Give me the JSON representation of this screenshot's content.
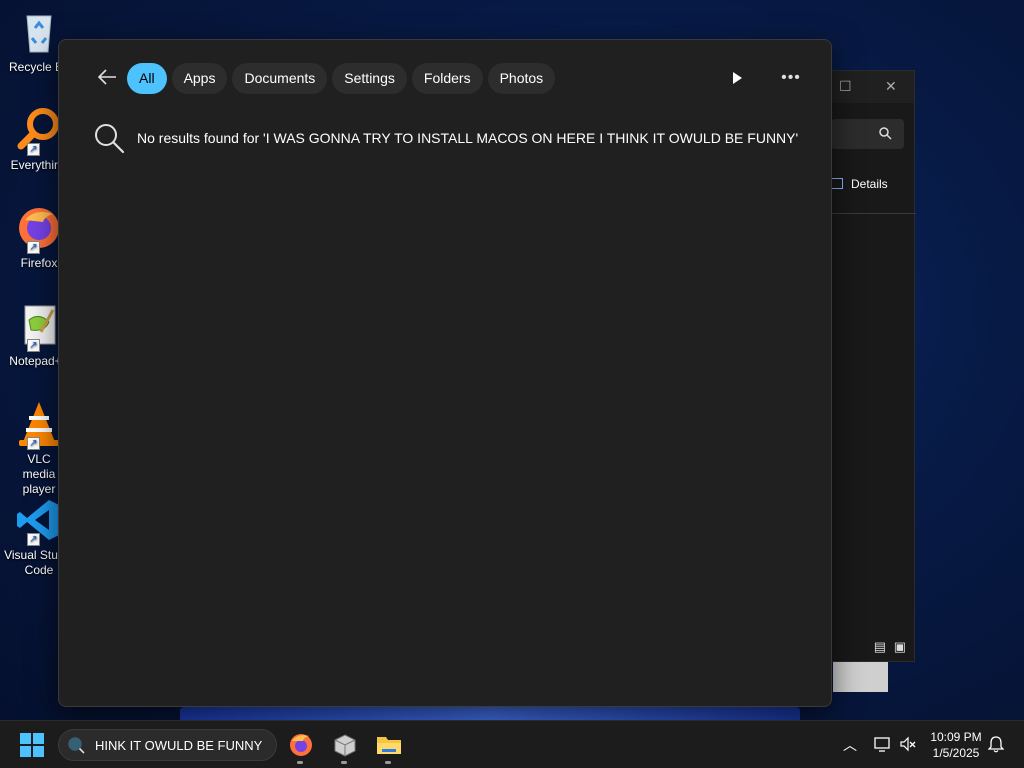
{
  "desktop": {
    "icons": [
      {
        "label": "Recycle Bin",
        "icon": "recycle-bin-icon"
      },
      {
        "label": "Everything",
        "icon": "everything-search-icon"
      },
      {
        "label": "Firefox",
        "icon": "firefox-icon"
      },
      {
        "label": "Notepad++",
        "icon": "notepad-plus-plus-icon"
      },
      {
        "label": "VLC media player",
        "icon": "vlc-icon"
      },
      {
        "label": "Visual Studio Code",
        "icon": "vscode-icon"
      }
    ]
  },
  "explorer": {
    "details_label": "Details"
  },
  "search_flyout": {
    "filters": [
      {
        "label": "All",
        "active": true
      },
      {
        "label": "Apps",
        "active": false
      },
      {
        "label": "Documents",
        "active": false
      },
      {
        "label": "Settings",
        "active": false
      },
      {
        "label": "Folders",
        "active": false
      },
      {
        "label": "Photos",
        "active": false
      }
    ],
    "no_results_text": "No results found for 'I WAS GONNA TRY TO INSTALL MACOS ON HERE I THINK IT OWULD BE FUNNY'"
  },
  "taskbar": {
    "search_value": "HINK IT OWULD BE FUNNY",
    "apps": [
      "firefox-icon",
      "package-icon",
      "file-explorer-icon"
    ],
    "clock": {
      "time": "10:09 PM",
      "date": "1/5/2025"
    }
  },
  "colors": {
    "accent": "#4cc2ff",
    "flyout_bg": "#202020",
    "pill_bg": "#2d2d2d",
    "taskbar_bg": "#1c1c1c"
  }
}
